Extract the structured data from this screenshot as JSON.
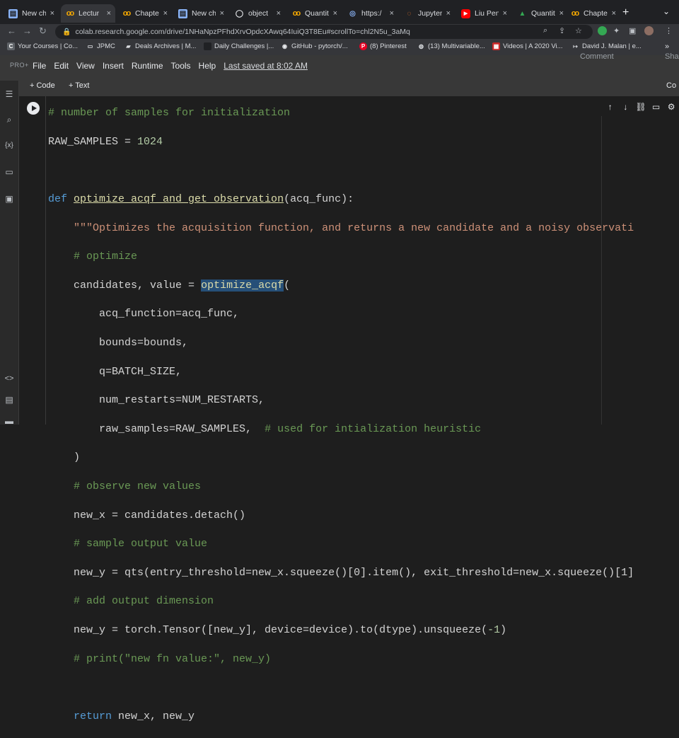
{
  "browser": {
    "tabs": [
      {
        "title": "New ch",
        "icon": "drive-doc-icon"
      },
      {
        "title": "Lectur",
        "icon": "colab-icon",
        "active": true
      },
      {
        "title": "Chapte",
        "icon": "colab-icon"
      },
      {
        "title": "New ch",
        "icon": "drive-doc-icon"
      },
      {
        "title": "object",
        "icon": "github-icon"
      },
      {
        "title": "Quantit",
        "icon": "colab-icon"
      },
      {
        "title": "https:/",
        "icon": "web-icon"
      },
      {
        "title": "Jupyter",
        "icon": "jupyter-icon"
      },
      {
        "title": "Liu Pen",
        "icon": "youtube-icon"
      },
      {
        "title": "Quantit",
        "icon": "drive-icon"
      },
      {
        "title": "Chapte",
        "icon": "colab-icon"
      }
    ],
    "close_glyph": "×",
    "new_tab_glyph": "+",
    "url": "colab.research.google.com/drive/1NHaNpzPFhdXrvOpdcXAwq64IuiQ3T8Eu#scrollTo=chl2N5u_3aMq",
    "bookmarks": [
      {
        "label": "Your Courses | Co..."
      },
      {
        "label": "JPMC"
      },
      {
        "label": "Deals Archives | M..."
      },
      {
        "label": "Daily Challenges |..."
      },
      {
        "label": "GitHub - pytorch/..."
      },
      {
        "label": "(8) Pinterest"
      },
      {
        "label": "(13) Multivariable..."
      },
      {
        "label": "Videos | A 2020 Vi..."
      },
      {
        "label": "David J. Malan | e..."
      }
    ]
  },
  "colab": {
    "pro_badge": "PRO+",
    "menu": [
      "File",
      "Edit",
      "View",
      "Insert",
      "Runtime",
      "Tools",
      "Help"
    ],
    "last_saved": "Last saved at 8:02 AM",
    "comment_label": "Comment",
    "share_label": "Sha",
    "add_code": "+ Code",
    "add_text": "+ Text",
    "connect_label": "Co"
  },
  "code": {
    "l01": "# number of samples for initialization",
    "l02a": "RAW_SAMPLES = ",
    "l02b": "1024",
    "l04kw": "def ",
    "l04name": "optimize_acqf_and_get_observation",
    "l04rest": "(acq_func):",
    "l05": "    \"\"\"Optimizes the acquisition function, and returns a new candidate and a noisy observati",
    "l06": "    # optimize",
    "l07a": "    candidates, value ",
    "l07b": "=",
    "l07c": " ",
    "l07d": "optimize_acqf",
    "l07e": "(",
    "l08": "        acq_function=acq_func,",
    "l09": "        bounds=bounds,",
    "l10": "        q=BATCH_SIZE,",
    "l11": "        num_restarts=NUM_RESTARTS,",
    "l12a": "        raw_samples=RAW_SAMPLES,  ",
    "l12b": "# used for intialization heuristic",
    "l13": "    )",
    "l14": "    # observe new values",
    "l15": "    new_x = candidates.detach()",
    "l16": "    # sample output value",
    "l17": "    new_y = qts(entry_threshold=new_x.squeeze()[0].item(), exit_threshold=new_x.squeeze()[1]",
    "l18": "    # add output dimension",
    "l19a": "    new_y = torch.Tensor([new_y], device=device).to(dtype).unsqueeze(",
    "l19b": "-1",
    "l19c": ")",
    "l20": "    # print(\"new fn value:\", new_y)",
    "l22kw": "    return",
    "l22rest": " new_x, new_y"
  }
}
